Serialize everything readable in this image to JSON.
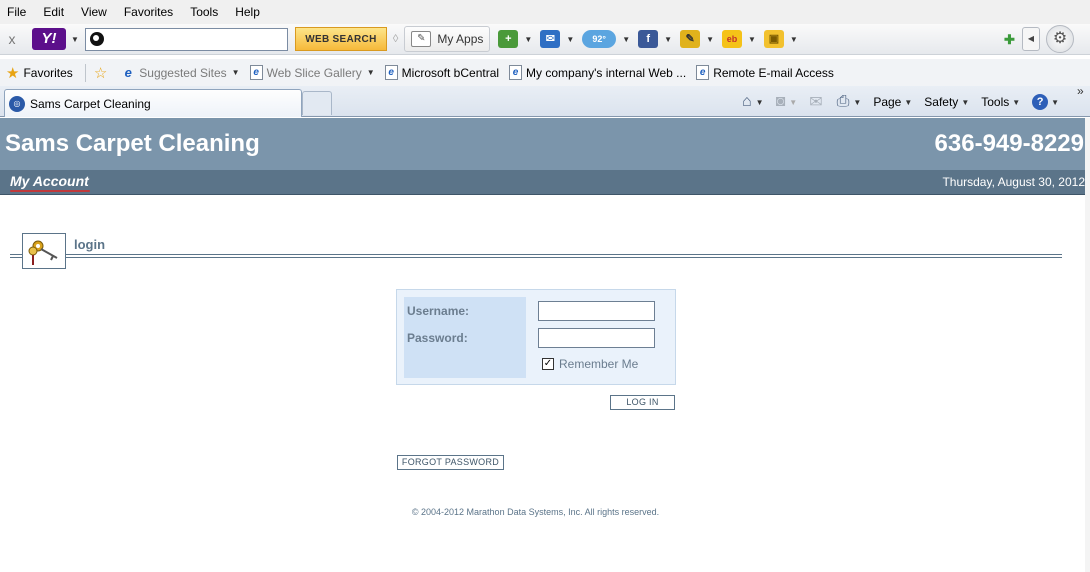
{
  "menu": [
    "File",
    "Edit",
    "View",
    "Favorites",
    "Tools",
    "Help"
  ],
  "yahoo_toolbar": {
    "close_glyph": "x",
    "logo": "Y!",
    "search_value": "",
    "search_button": "WEB SEARCH",
    "my_apps": "My Apps",
    "weather_badge": "92°",
    "icons": [
      "add-icon",
      "mail-icon",
      "weather-icon",
      "facebook-icon",
      "note-icon",
      "ebay-icon",
      "bag-icon"
    ]
  },
  "favorites_bar": {
    "favorites_label": "Favorites",
    "items": [
      "Suggested Sites",
      "Web Slice Gallery",
      "Microsoft bCentral",
      "My company's internal Web ...",
      "Remote E-mail Access"
    ]
  },
  "tab": {
    "title": "Sams Carpet Cleaning"
  },
  "command_bar": {
    "page": "Page",
    "safety": "Safety",
    "tools": "Tools"
  },
  "site": {
    "title": "Sams Carpet Cleaning",
    "phone": "636-949-8229",
    "my_account": "My Account",
    "date": "Thursday, August 30, 2012"
  },
  "login": {
    "section_label": "login",
    "username_label": "Username:",
    "password_label": "Password:",
    "username_value": "",
    "password_value": "",
    "remember_label": "Remember Me",
    "remember_checked": true,
    "login_button": "LOG IN",
    "forgot_button": "FORGOT PASSWORD"
  },
  "footer": {
    "copyright": "© 2004-2012 Marathon Data Systems, Inc.  All rights reserved."
  },
  "colors": {
    "header": "#7b95ab",
    "subbar": "#5b7489",
    "panel": "#eaf2fb",
    "label_column": "#cfe1f5"
  }
}
